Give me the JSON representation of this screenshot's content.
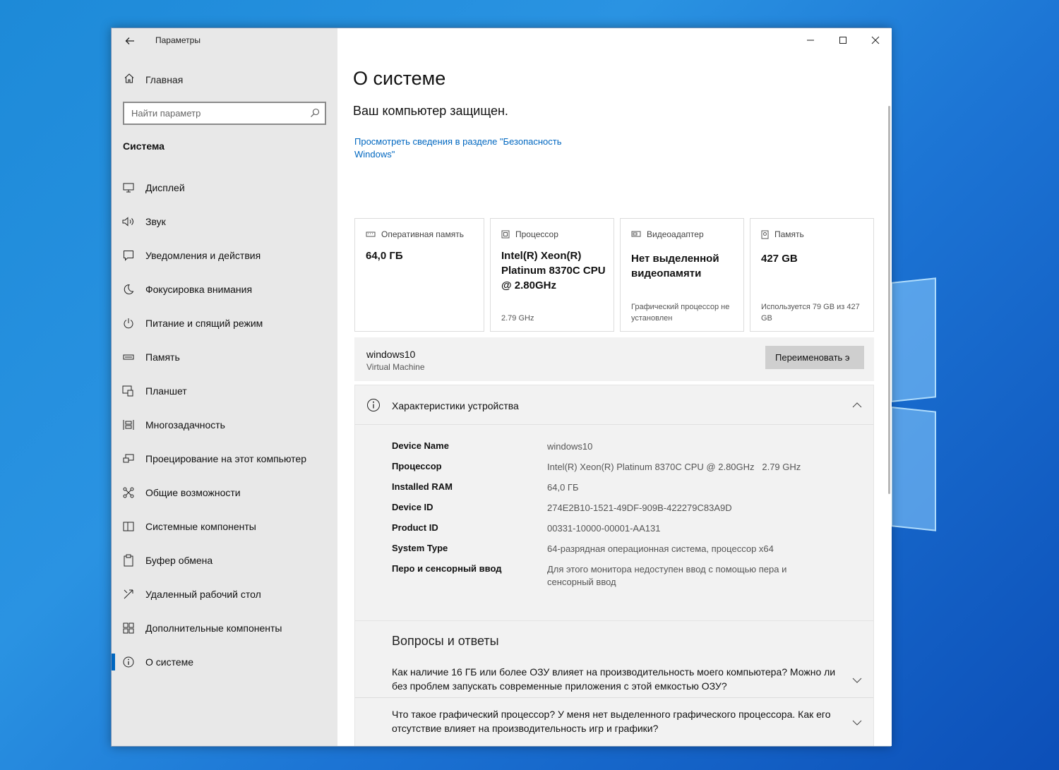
{
  "app": {
    "title": "Параметры"
  },
  "sidebar": {
    "home_label": "Главная",
    "search_placeholder": "Найти параметр",
    "section_title": "Система",
    "items": [
      {
        "label": "Дисплей",
        "icon": "display-icon"
      },
      {
        "label": "Звук",
        "icon": "speaker-icon"
      },
      {
        "label": "Уведомления и действия",
        "icon": "notification-icon"
      },
      {
        "label": "Фокусировка внимания",
        "icon": "moon-icon"
      },
      {
        "label": "Питание и спящий режим",
        "icon": "power-icon"
      },
      {
        "label": "Память",
        "icon": "storage-icon"
      },
      {
        "label": "Планшет",
        "icon": "tablet-icon"
      },
      {
        "label": "Многозадачность",
        "icon": "multitasking-icon"
      },
      {
        "label": "Проецирование на этот компьютер",
        "icon": "projection-icon"
      },
      {
        "label": "Общие возможности",
        "icon": "shared-experiences-icon"
      },
      {
        "label": "Системные компоненты",
        "icon": "system-components-icon"
      },
      {
        "label": "Буфер обмена",
        "icon": "clipboard-icon"
      },
      {
        "label": "Удаленный рабочий стол",
        "icon": "remote-desktop-icon"
      },
      {
        "label": "Дополнительные компоненты",
        "icon": "optional-features-icon"
      },
      {
        "label": "О системе",
        "icon": "info-icon",
        "active": true
      }
    ]
  },
  "main": {
    "title": "О системе",
    "protection_status": "Ваш компьютер защищен.",
    "security_link": "Просмотреть сведения в разделе \"Безопасность Windows\"",
    "cards": {
      "ram": {
        "label": "Оперативная память",
        "value": "64,0 ГБ"
      },
      "cpu": {
        "label": "Процессор",
        "value": "Intel(R) Xeon(R) Platinum 8370C CPU @ 2.80GHz",
        "sub": "2.79 GHz"
      },
      "gpu": {
        "label": "Видеоадаптер",
        "value": "Нет выделенной видеопамяти",
        "sub": "Графический процессор не установлен"
      },
      "storage": {
        "label": "Память",
        "value": "427 GB",
        "sub": "Используется 79 GB из 427 GB"
      }
    },
    "device": {
      "name": "windows10",
      "type": "Virtual Machine",
      "rename_label": "Переименовать э"
    },
    "specs": {
      "title": "Характеристики устройства",
      "rows": [
        {
          "key": "Device Name",
          "value": "windows10"
        },
        {
          "key": "Процессор",
          "value": "Intel(R) Xeon(R) Platinum 8370C CPU @ 2.80GHz   2.79 GHz"
        },
        {
          "key": "Installed RAM",
          "value": "64,0 ГБ"
        },
        {
          "key": "Device ID",
          "value": "274E2B10-1521-49DF-909B-422279C83A9D"
        },
        {
          "key": "Product ID",
          "value": "00331-10000-00001-AA131"
        },
        {
          "key": "System Type",
          "value": "64-разрядная операционная система, процессор x64"
        },
        {
          "key": "Перо и сенсорный ввод",
          "value": "Для этого монитора недоступен ввод с помощью пера и сенсорный ввод"
        }
      ]
    },
    "faq": {
      "title": "Вопросы и ответы",
      "items": [
        {
          "question": "Как наличие 16 ГБ или более ОЗУ влияет на производительность моего компьютера? Можно ли без проблем запускать современные приложения с этой емкостью ОЗУ?"
        },
        {
          "question": "Что такое графический процессор? У меня нет выделенного графического процессора. Как его отсутствие влияет на производительность игр и графики?"
        }
      ]
    }
  },
  "colors": {
    "accent": "#0067c0",
    "sidebar_bg": "#e8e8e8",
    "panel_bg": "#f2f2f2"
  }
}
